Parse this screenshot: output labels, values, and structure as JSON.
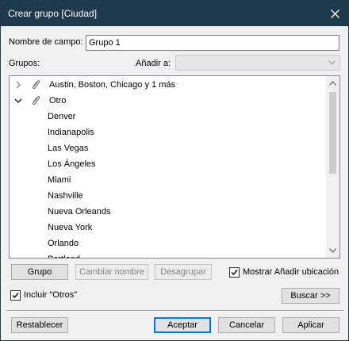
{
  "window": {
    "title": "Crear grupo [Ciudad]"
  },
  "form": {
    "field_name_label": "Nombre de campo:",
    "field_name_value": "Grupo 1",
    "groups_label": "Grupos:",
    "add_to_label": "Añadir a:",
    "add_to_value": ""
  },
  "tree": {
    "items": [
      {
        "label": "Austin, Boston, Chicago y 1 más",
        "level": 0,
        "expanded": false
      },
      {
        "label": "Otro",
        "level": 0,
        "expanded": true
      },
      {
        "label": "Denver",
        "level": 1
      },
      {
        "label": "Indianapolis",
        "level": 1
      },
      {
        "label": "Las Vegas",
        "level": 1
      },
      {
        "label": "Los Ángeles",
        "level": 1
      },
      {
        "label": "Miami",
        "level": 1
      },
      {
        "label": "Nashville",
        "level": 1
      },
      {
        "label": "Nueva Orleands",
        "level": 1
      },
      {
        "label": "Nueva York",
        "level": 1
      },
      {
        "label": "Orlando",
        "level": 1
      },
      {
        "label": "Portland",
        "level": 1
      }
    ]
  },
  "buttons": {
    "group": "Grupo",
    "rename": "Cambiar nombre",
    "ungroup": "Desagrupar",
    "find": "Buscar >>",
    "reset": "Restablecer",
    "ok": "Aceptar",
    "cancel": "Cancelar",
    "apply": "Aplicar"
  },
  "options": {
    "show_add_location": {
      "label": "Mostrar Añadir ubicación",
      "checked": true
    },
    "include_others": {
      "label": "Incluir \"Otros\"",
      "checked": true
    }
  },
  "colors": {
    "titlebar": "#1e3a4c",
    "accent": "#0078d7"
  }
}
